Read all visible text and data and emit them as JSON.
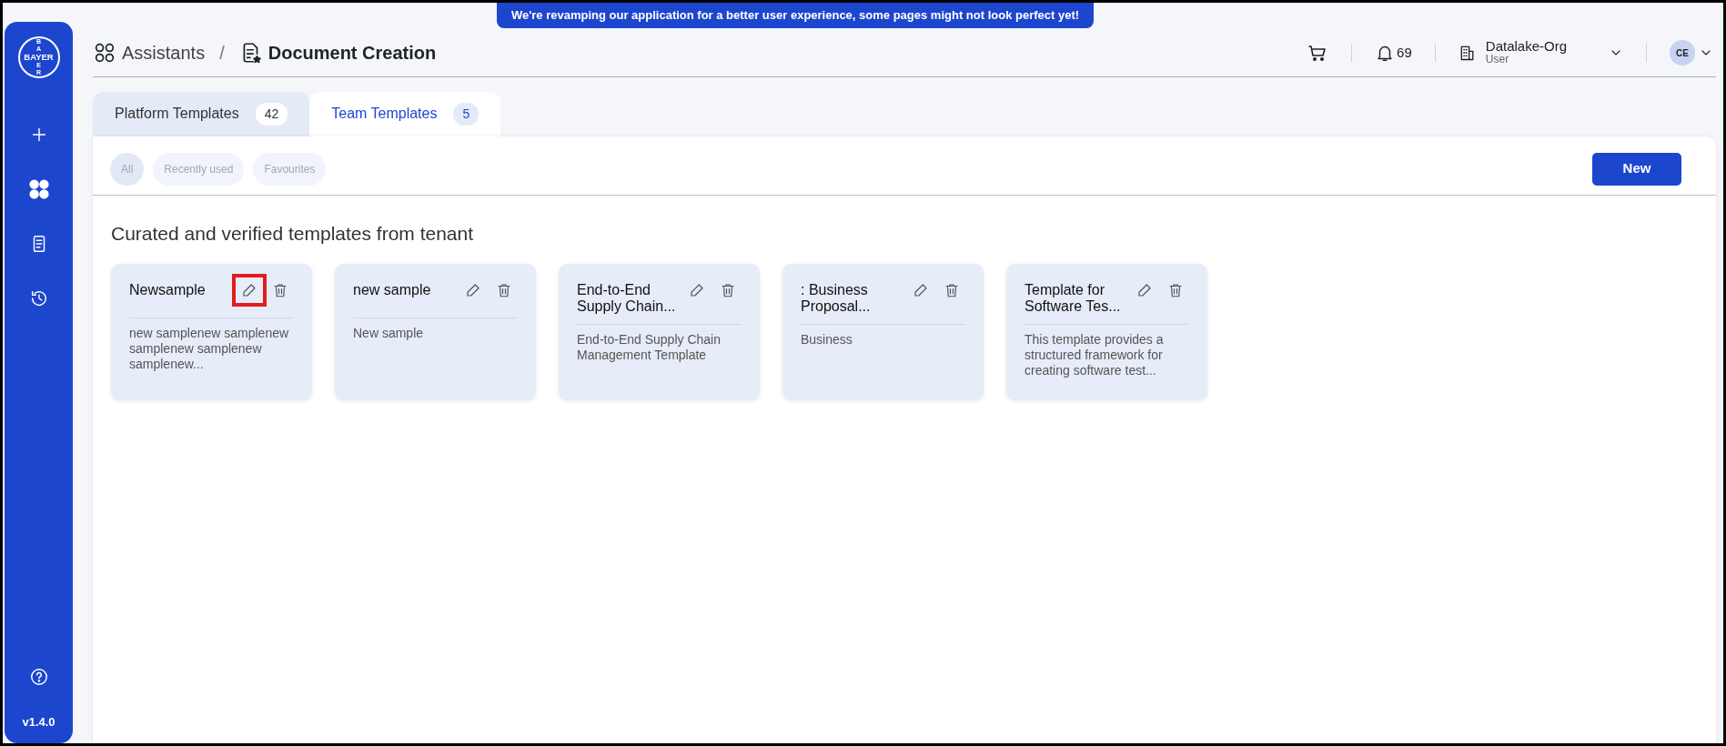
{
  "banner": "We're revamping our application for a better user experience, some pages might not look perfect yet!",
  "sidebar": {
    "logo": {
      "vertical_top": "BA",
      "horizontal": "BAYER",
      "vertical_bottom": "ER"
    },
    "items": [
      {
        "kind": "add"
      },
      {
        "kind": "apps"
      },
      {
        "kind": "document"
      },
      {
        "kind": "history"
      }
    ],
    "help": {
      "kind": "help"
    },
    "version": "v1.4.0"
  },
  "breadcrumb_separator": "/",
  "breadcrumb": [
    {
      "label": "Assistants",
      "kind": "apps"
    },
    {
      "label": "Document Creation",
      "kind": "document"
    }
  ],
  "header": {
    "notifications": "69",
    "org": {
      "name": "Datalake-Org",
      "role": "User"
    },
    "avatar": "CE"
  },
  "tabs": [
    {
      "label": "Platform Templates",
      "count": "42",
      "selected": false
    },
    {
      "label": "Team Templates",
      "count": "5",
      "selected": true
    }
  ],
  "filters": [
    {
      "label": "All",
      "selected": true
    },
    {
      "label": "Recently used",
      "selected": false
    },
    {
      "label": "Favourites",
      "selected": false
    }
  ],
  "new_button": "New",
  "section_title": "Curated and verified templates from tenant",
  "cards": [
    {
      "title": "Newsample",
      "description": "new samplenew samplenew samplenew samplenew samplenew...",
      "edit_highlighted": true
    },
    {
      "title": "new sample",
      "description": "New sample",
      "edit_highlighted": false
    },
    {
      "title": "End-to-End Supply Chain...",
      "description": "End-to-End Supply Chain Management Template",
      "edit_highlighted": false
    },
    {
      "title": ": Business Proposal...",
      "description": "Business",
      "edit_highlighted": false
    },
    {
      "title": "Template for Software Tes...",
      "description": "This template provides a structured framework for creating software test...",
      "edit_highlighted": false
    }
  ]
}
